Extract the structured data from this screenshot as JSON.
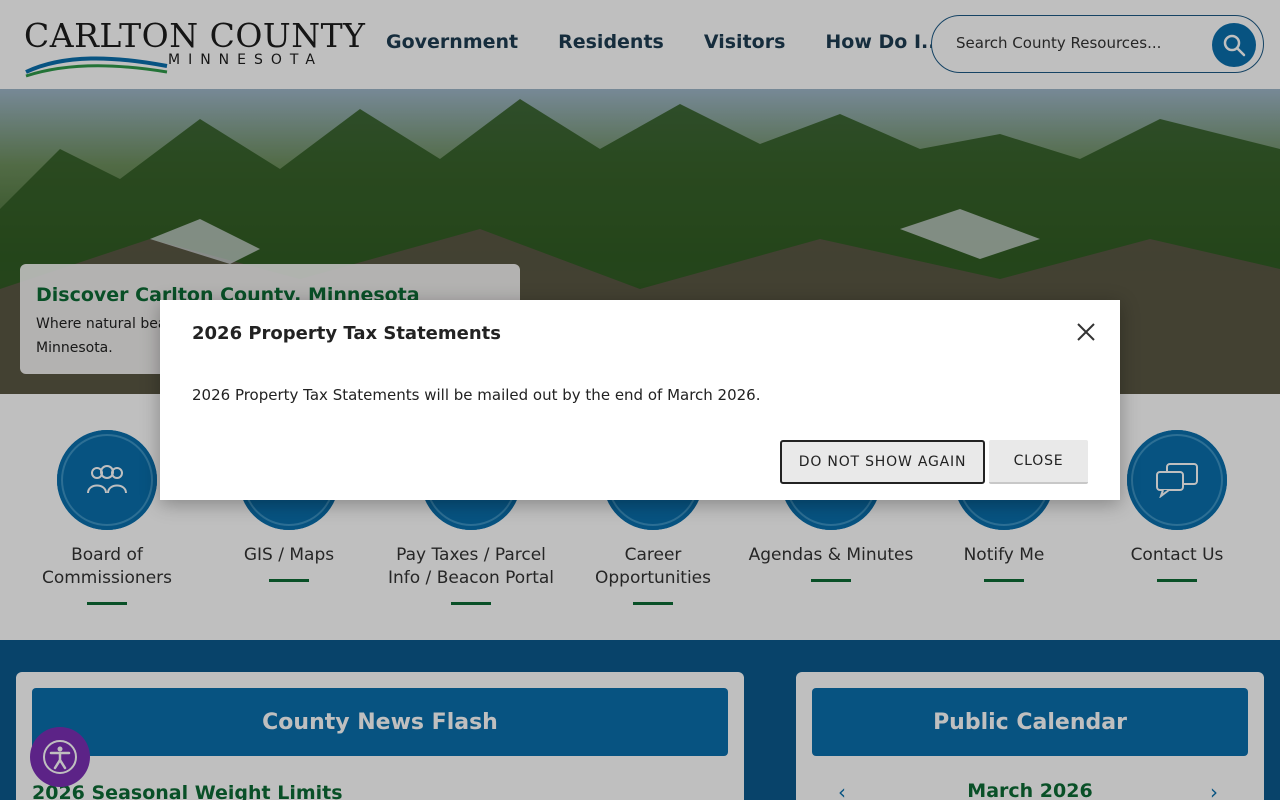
{
  "logo": {
    "title": "CARLTON COUNTY",
    "subtitle": "MINNESOTA"
  },
  "nav": {
    "items": [
      "Government",
      "Residents",
      "Visitors",
      "How Do I..."
    ]
  },
  "search": {
    "placeholder": "Search County Resources..."
  },
  "hero": {
    "title": "Discover Carlton County, Minnesota",
    "text": "Where natural beauty meets small-town charm in northeastern Minnesota."
  },
  "quick_links": [
    {
      "label": "Board of Commissioners",
      "icon": "people-group-icon"
    },
    {
      "label": "GIS / Maps",
      "icon": "map-icon"
    },
    {
      "label": "Pay Taxes / Parcel Info / Beacon Portal",
      "icon": "money-icon"
    },
    {
      "label": "Career Opportunities",
      "icon": "briefcase-icon"
    },
    {
      "label": "Agendas & Minutes",
      "icon": "document-icon"
    },
    {
      "label": "Notify Me",
      "icon": "bell-icon"
    },
    {
      "label": "Contact Us",
      "icon": "chat-bubbles-icon"
    }
  ],
  "news": {
    "heading": "County News Flash",
    "first_item": "2026 Seasonal Weight Limits"
  },
  "calendar": {
    "heading": "Public Calendar",
    "month": "March 2026"
  },
  "modal": {
    "title": "2026 Property Tax Statements",
    "body": "2026 Property Tax Statements will be mailed out by the end of March 2026.",
    "dont_show_label": "DO NOT SHOW AGAIN",
    "close_label": "CLOSE"
  },
  "colors": {
    "primary_blue": "#0a6fad",
    "dark_blue": "#0b5a8e",
    "green": "#0d6b35",
    "accessibility_purple": "#7b2fb5"
  }
}
